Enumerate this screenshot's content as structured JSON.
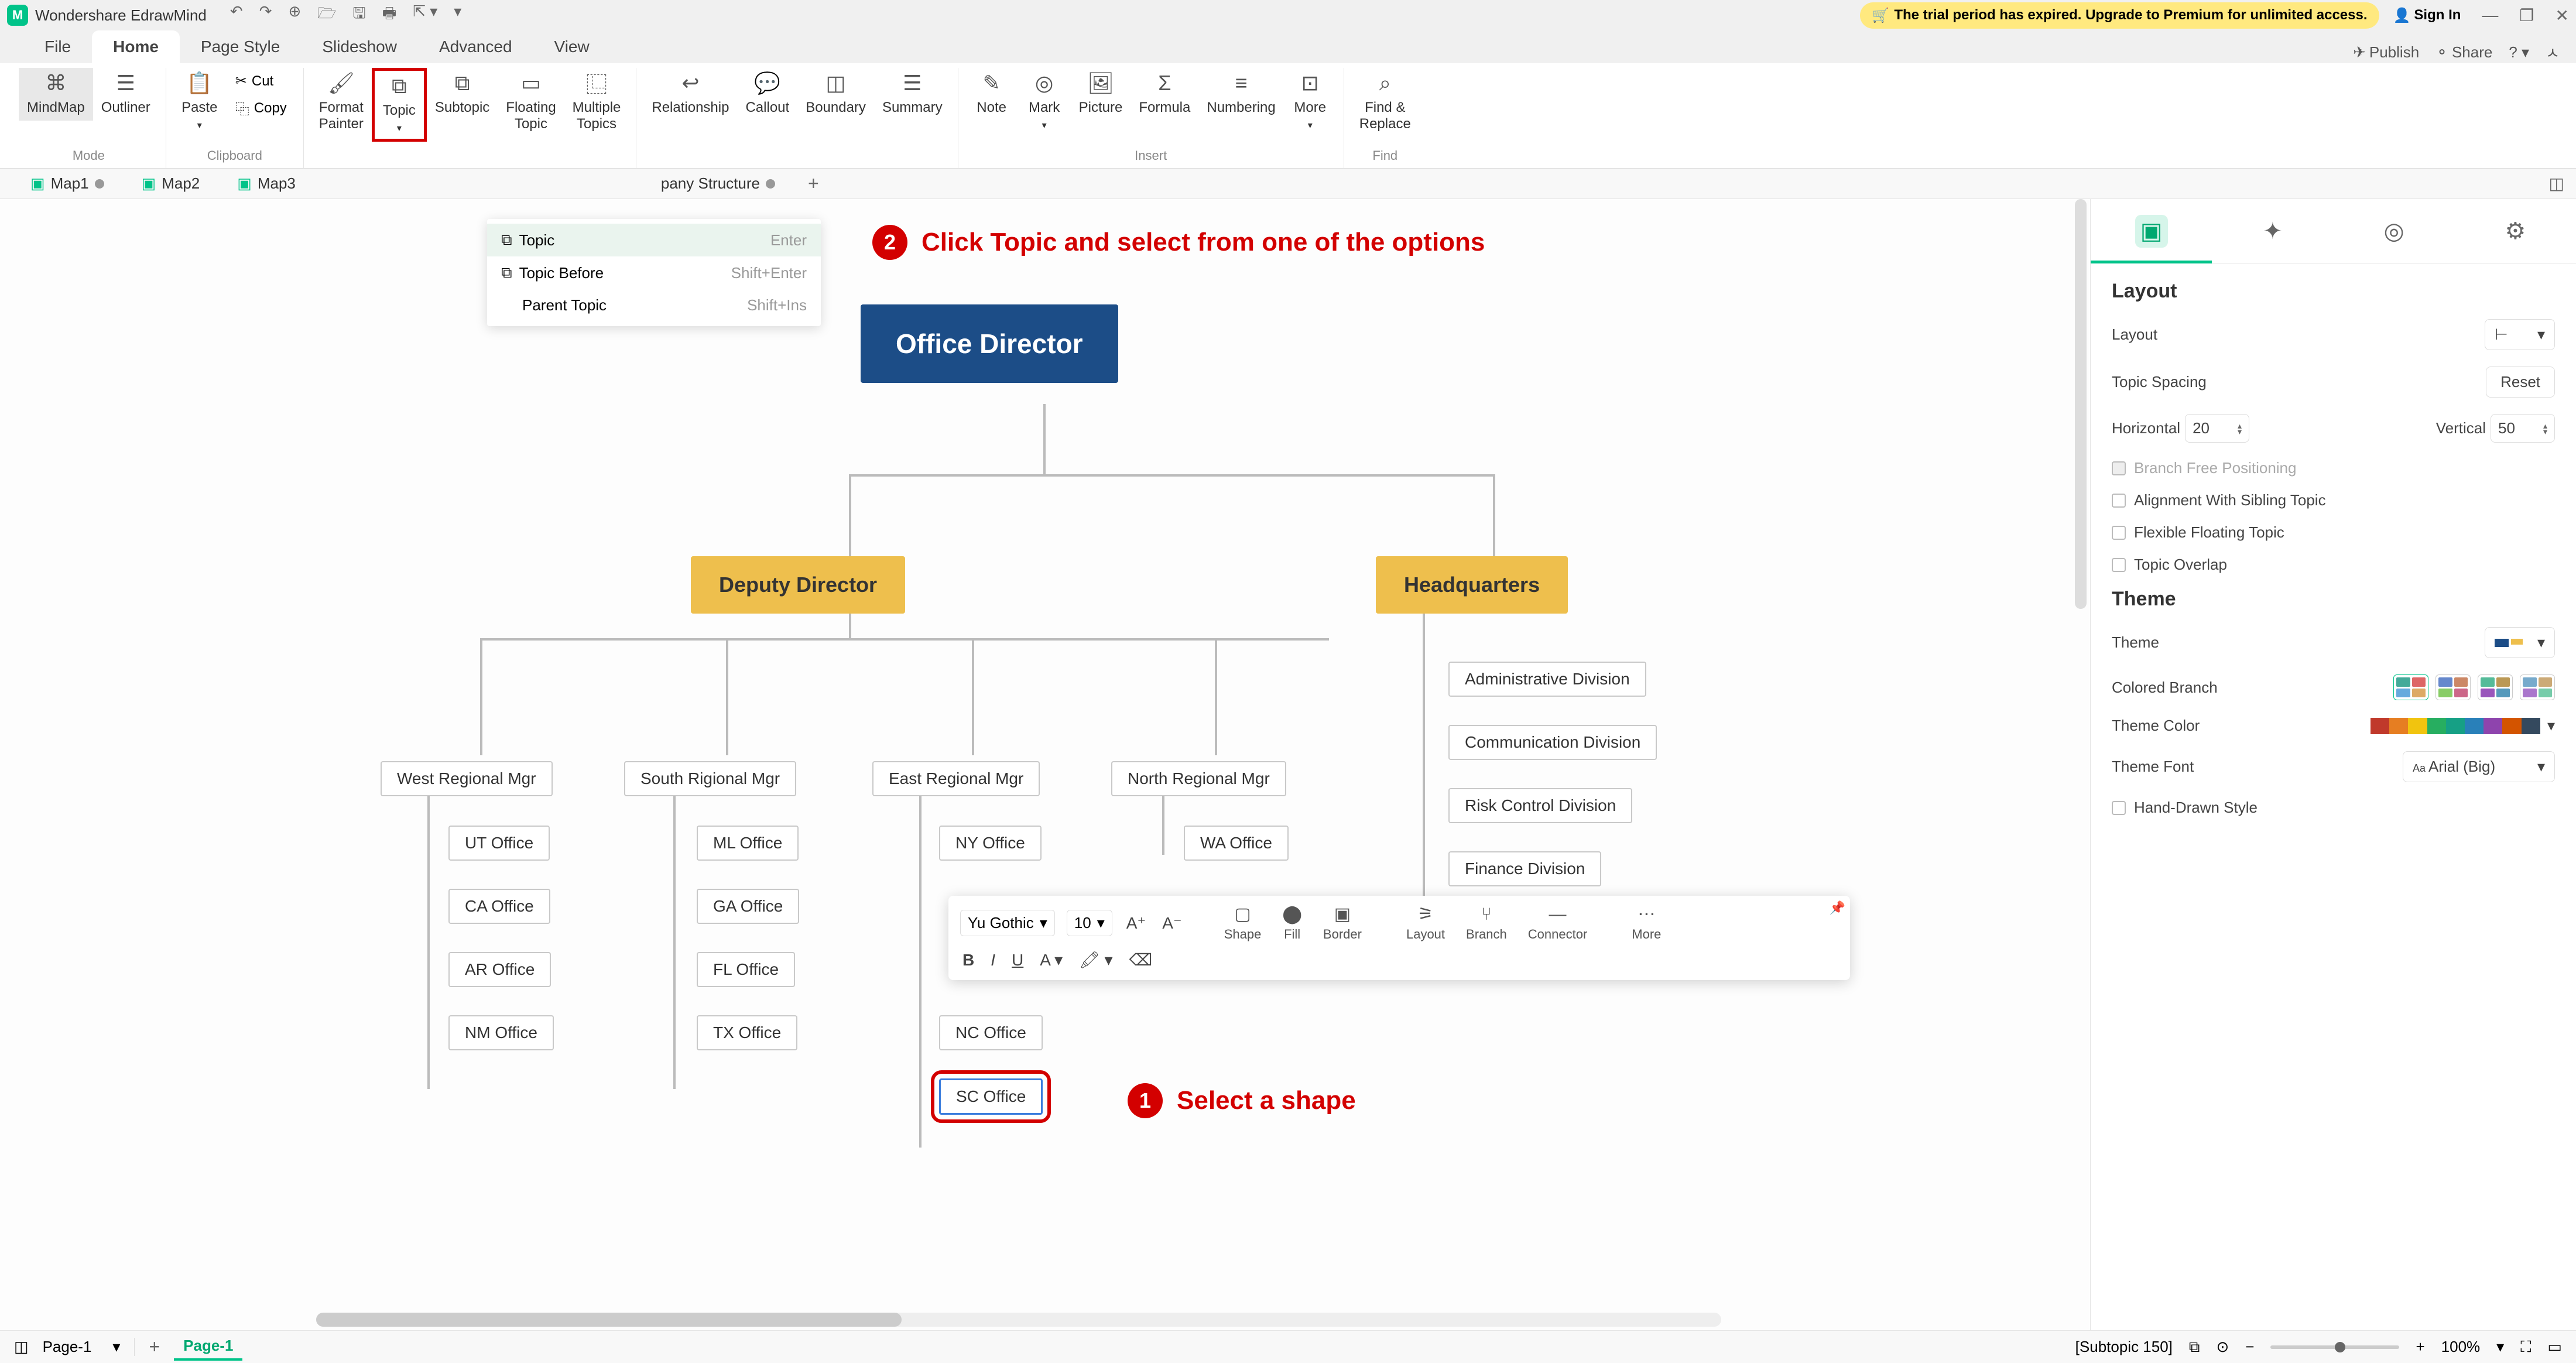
{
  "app": {
    "title": "Wondershare EdrawMind"
  },
  "trial_banner": "The trial period has expired. Upgrade to Premium for unlimited access.",
  "signin_label": "Sign In",
  "menu": {
    "items": [
      "File",
      "Home",
      "Page Style",
      "Slideshow",
      "Advanced",
      "View"
    ],
    "active_index": 1,
    "publish": "Publish",
    "share": "Share"
  },
  "ribbon": {
    "mode_label": "Mode",
    "mindmap": "MindMap",
    "outliner": "Outliner",
    "clipboard_label": "Clipboard",
    "paste": "Paste",
    "cut": "Cut",
    "copy": "Copy",
    "format_painter": "Format\nPainter",
    "topic": "Topic",
    "subtopic": "Subtopic",
    "floating_topic": "Floating\nTopic",
    "multiple_topics": "Multiple\nTopics",
    "relationship": "Relationship",
    "callout": "Callout",
    "boundary": "Boundary",
    "summary": "Summary",
    "insert_label": "Insert",
    "note": "Note",
    "mark": "Mark",
    "picture": "Picture",
    "formula": "Formula",
    "numbering": "Numbering",
    "more": "More",
    "find_replace": "Find &\nReplace",
    "find_label": "Find"
  },
  "topic_dropdown": {
    "items": [
      {
        "label": "Topic",
        "shortcut": "Enter"
      },
      {
        "label": "Topic Before",
        "shortcut": "Shift+Enter"
      },
      {
        "label": "Parent Topic",
        "shortcut": "Shift+Ins"
      }
    ]
  },
  "doc_tabs": {
    "items": [
      "Map1",
      "Map2",
      "Map3"
    ],
    "partial_tab": "pany Structure",
    "active_index": 4
  },
  "annotations": {
    "a1": {
      "num": "1",
      "text": "Select a shape"
    },
    "a2": {
      "num": "2",
      "text": "Click Topic and select from one of the options"
    }
  },
  "org": {
    "root": "Office Director",
    "deputy": "Deputy Director",
    "hq": "Headquarters",
    "west": "West Regional Mgr",
    "south": "South Rigional Mgr",
    "east": "East Regional Mgr",
    "north": "North Regional Mgr",
    "west_children": [
      "UT Office",
      "CA Office",
      "AR Office",
      "NM Office"
    ],
    "south_children": [
      "ML Office",
      "GA Office",
      "FL Office",
      "TX Office"
    ],
    "east_children": [
      "NY Office",
      "",
      "NC Office",
      "SC Office"
    ],
    "north_children": [
      "WA Office"
    ],
    "hq_children": [
      "Administrative Division",
      "Communication Division",
      "Risk Control Division",
      "Finance Division"
    ]
  },
  "floating_toolbar": {
    "font": "Yu Gothic",
    "size": "10",
    "shape": "Shape",
    "fill": "Fill",
    "border": "Border",
    "layout": "Layout",
    "branch": "Branch",
    "connector": "Connector",
    "more": "More"
  },
  "sidepanel": {
    "layout_title": "Layout",
    "layout_label": "Layout",
    "topic_spacing": "Topic Spacing",
    "reset": "Reset",
    "horizontal": "Horizontal",
    "horizontal_val": "20",
    "vertical": "Vertical",
    "vertical_val": "50",
    "branch_free": "Branch Free Positioning",
    "alignment_sibling": "Alignment With Sibling Topic",
    "flexible_floating": "Flexible Floating Topic",
    "topic_overlap": "Topic Overlap",
    "theme_title": "Theme",
    "theme_label": "Theme",
    "colored_branch": "Colored Branch",
    "theme_color": "Theme Color",
    "theme_font": "Theme Font",
    "theme_font_val": "Arial (Big)",
    "hand_drawn": "Hand-Drawn Style"
  },
  "statusbar": {
    "page_dropdown": "Page-1",
    "page_tab": "Page-1",
    "subtopic_info": "[Subtopic 150]",
    "zoom": "100%"
  }
}
